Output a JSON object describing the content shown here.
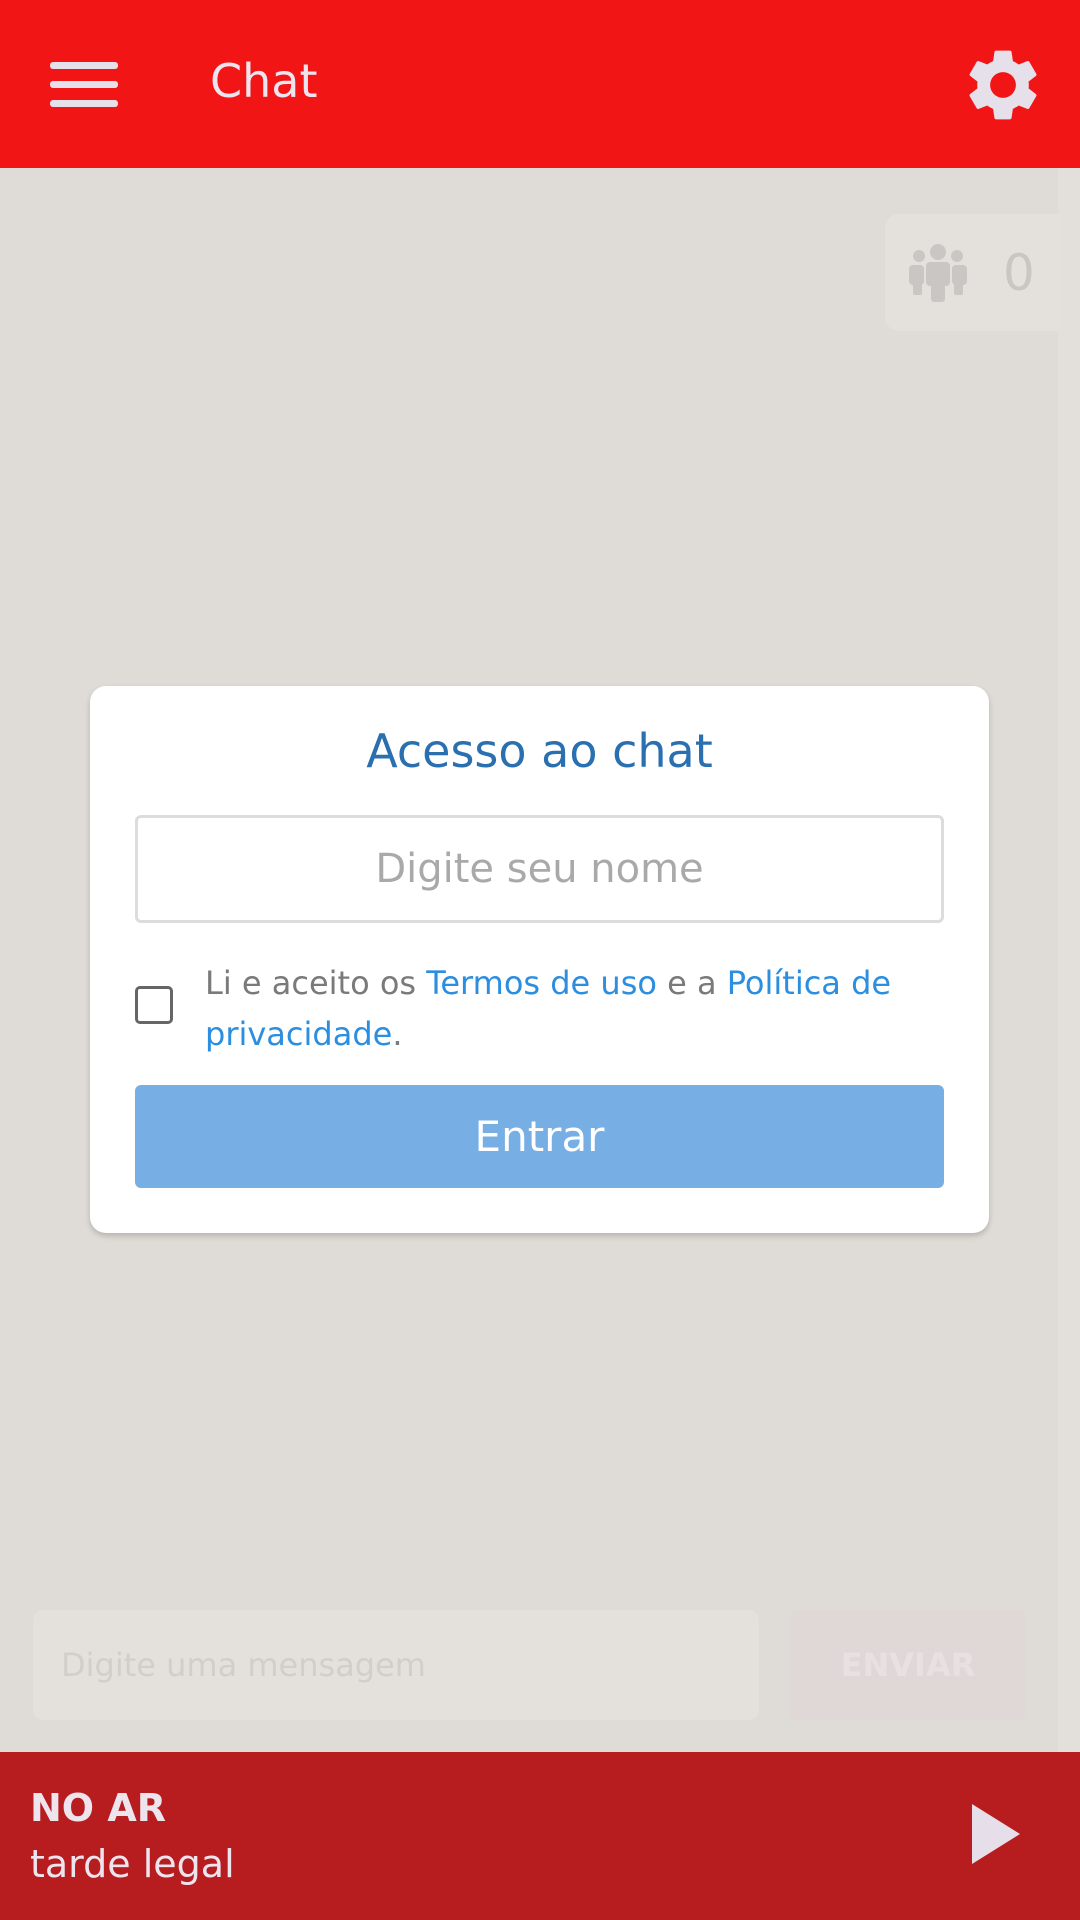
{
  "header": {
    "title": "Chat",
    "menu_icon": "hamburger-icon",
    "settings_icon": "gear-icon"
  },
  "users_online": {
    "icon": "users-icon",
    "count": "0"
  },
  "login_modal": {
    "title": "Acesso ao chat",
    "name_placeholder": "Digite seu nome",
    "name_value": "",
    "terms_checked": false,
    "terms_prefix": "Li e aceito os ",
    "terms_link": "Termos de uso",
    "terms_middle": " e a ",
    "privacy_link": "Política de privacidade",
    "terms_suffix": ".",
    "enter_label": "Entrar"
  },
  "composer": {
    "placeholder": "Digite uma mensagem",
    "send_label": "ENVIAR"
  },
  "player": {
    "status": "NO AR",
    "program": "tarde legal",
    "play_icon": "play-icon"
  },
  "colors": {
    "header": "#f21515",
    "player": "#b71c1e",
    "accent": "#2b8ee0",
    "button": "#77afe5"
  }
}
